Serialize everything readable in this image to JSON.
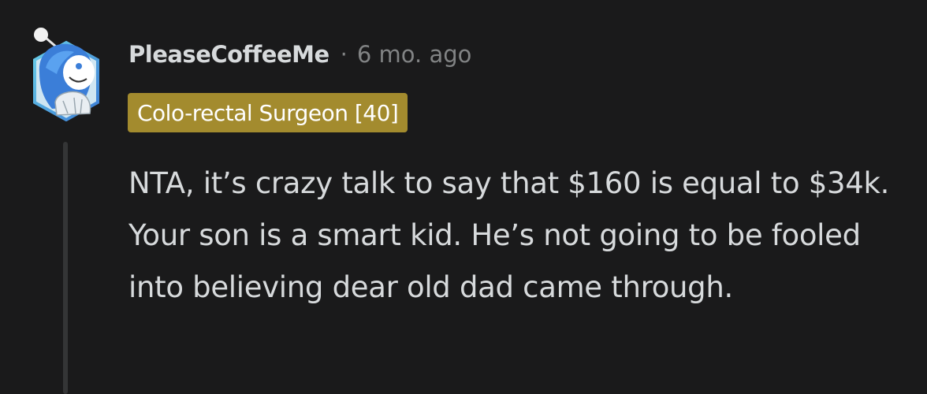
{
  "comment": {
    "username": "PleaseCoffeeMe",
    "separator": "·",
    "timestamp": "6 mo. ago",
    "flair": "Colo-rectal Surgeon [40]",
    "body": "NTA, it’s crazy talk to say that $160 is equal to $34k. Your son is a smart kid. He’s not going to be fooled into believing dear old dad came through."
  },
  "colors": {
    "background": "#1a1a1b",
    "text": "#d7dadc",
    "meta": "#818384",
    "flair_bg": "#a38b2e",
    "thread_line": "#343536"
  },
  "icons": {
    "avatar": "snoo-avatar-blue-hair"
  }
}
